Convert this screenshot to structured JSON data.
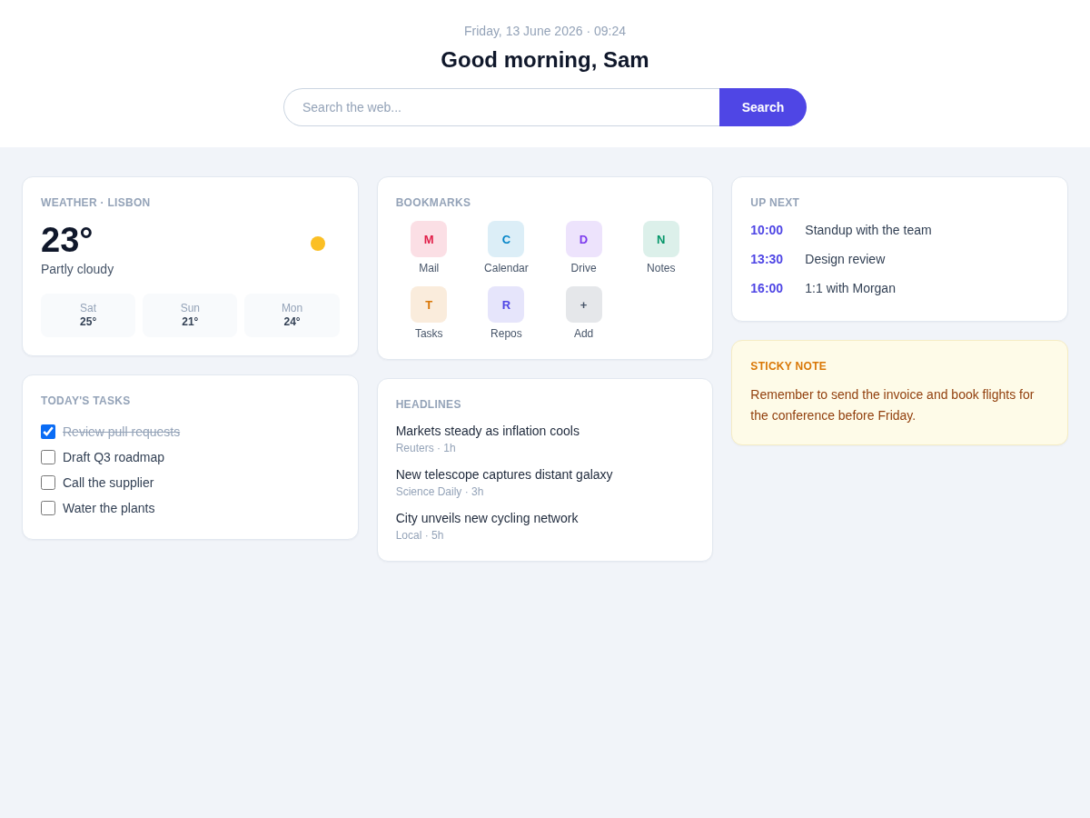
{
  "header": {
    "date": "Friday, 13 June 2026 · 09:24",
    "greeting": "Good morning, Sam",
    "search": {
      "placeholder": "Search the web...",
      "button": "Search"
    }
  },
  "weather": {
    "title": "WEATHER · LISBON",
    "temperature": "23°",
    "condition": "Partly cloudy",
    "forecast": [
      {
        "day": "Sat",
        "temp": "25°"
      },
      {
        "day": "Sun",
        "temp": "21°"
      },
      {
        "day": "Mon",
        "temp": "24°"
      }
    ]
  },
  "tasks": {
    "title": "TODAY'S TASKS",
    "items": [
      {
        "label": "Review pull requests",
        "checked": true
      },
      {
        "label": "Draft Q3 roadmap",
        "checked": false
      },
      {
        "label": "Call the supplier",
        "checked": false
      },
      {
        "label": "Water the plants",
        "checked": false
      }
    ]
  },
  "bookmarks": {
    "title": "BOOKMARKS",
    "items": [
      {
        "letter": "M",
        "label": "Mail",
        "color": "#e11d48"
      },
      {
        "letter": "C",
        "label": "Calendar",
        "color": "#0284c7"
      },
      {
        "letter": "D",
        "label": "Drive",
        "color": "#7c3aed"
      },
      {
        "letter": "N",
        "label": "Notes",
        "color": "#059669"
      },
      {
        "letter": "T",
        "label": "Tasks",
        "color": "#d97706"
      },
      {
        "letter": "R",
        "label": "Repos",
        "color": "#4f46e5"
      },
      {
        "letter": "+",
        "label": "Add",
        "color": "#475569"
      }
    ]
  },
  "headlines": {
    "title": "HEADLINES",
    "items": [
      {
        "title": "Markets steady as inflation cools",
        "meta": "Reuters · 1h"
      },
      {
        "title": "New telescope captures distant galaxy",
        "meta": "Science Daily · 3h"
      },
      {
        "title": "City unveils new cycling network",
        "meta": "Local · 5h"
      }
    ]
  },
  "up_next": {
    "title": "UP NEXT",
    "events": [
      {
        "time": "10:00",
        "title": "Standup with the team"
      },
      {
        "time": "13:30",
        "title": "Design review"
      },
      {
        "time": "16:00",
        "title": "1:1 with Morgan"
      }
    ]
  },
  "sticky_note": {
    "title": "STICKY NOTE",
    "text": "Remember to send the invoice and book flights for the conference before Friday."
  }
}
